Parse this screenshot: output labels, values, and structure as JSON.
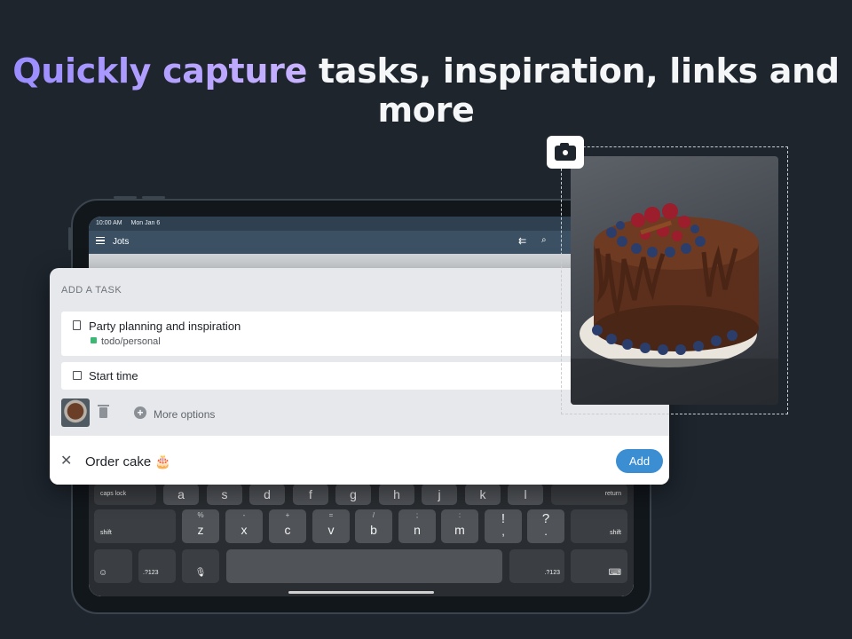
{
  "headline": {
    "accent": "Quickly capture",
    "rest": " tasks, inspiration, links and more"
  },
  "status": {
    "time": "10:00 AM",
    "date": "Mon Jan 6"
  },
  "appbar": {
    "title": "Jots"
  },
  "sheet": {
    "label": "ADD A TASK",
    "note_title": "Party planning and inspiration",
    "note_tag": "todo/personal",
    "start_time": "Start time",
    "more_options": "More options",
    "input_value": "Order cake 🎂",
    "add_label": "Add"
  },
  "keyboard": {
    "row1_fn": "caps lock",
    "row1": [
      "a",
      "s",
      "d",
      "f",
      "g",
      "h",
      "j",
      "k",
      "l"
    ],
    "return": "return",
    "shift": "shift",
    "row2": [
      {
        "main": "z",
        "sub": "%"
      },
      {
        "main": "x",
        "sub": "-"
      },
      {
        "main": "c",
        "sub": "+"
      },
      {
        "main": "v",
        "sub": "="
      },
      {
        "main": "b",
        "sub": "/"
      },
      {
        "main": "n",
        "sub": ";"
      },
      {
        "main": "m",
        "sub": ":"
      },
      {
        "main": ",",
        "sub": "!"
      },
      {
        "main": ".",
        "sub": "?"
      }
    ],
    "numkey": ".?123"
  },
  "colors": {
    "background": "#1e252d",
    "accent": "#9b8cff",
    "add_button": "#3c8ed2",
    "tag": "#3bb874"
  },
  "icons": [
    "menu-icon",
    "collapse-icon",
    "search-icon",
    "document-icon",
    "calendar-icon",
    "trash-icon",
    "plus-circle-icon",
    "close-icon",
    "camera-icon",
    "emoji-icon",
    "mic-icon",
    "keyboard-hide-icon"
  ]
}
